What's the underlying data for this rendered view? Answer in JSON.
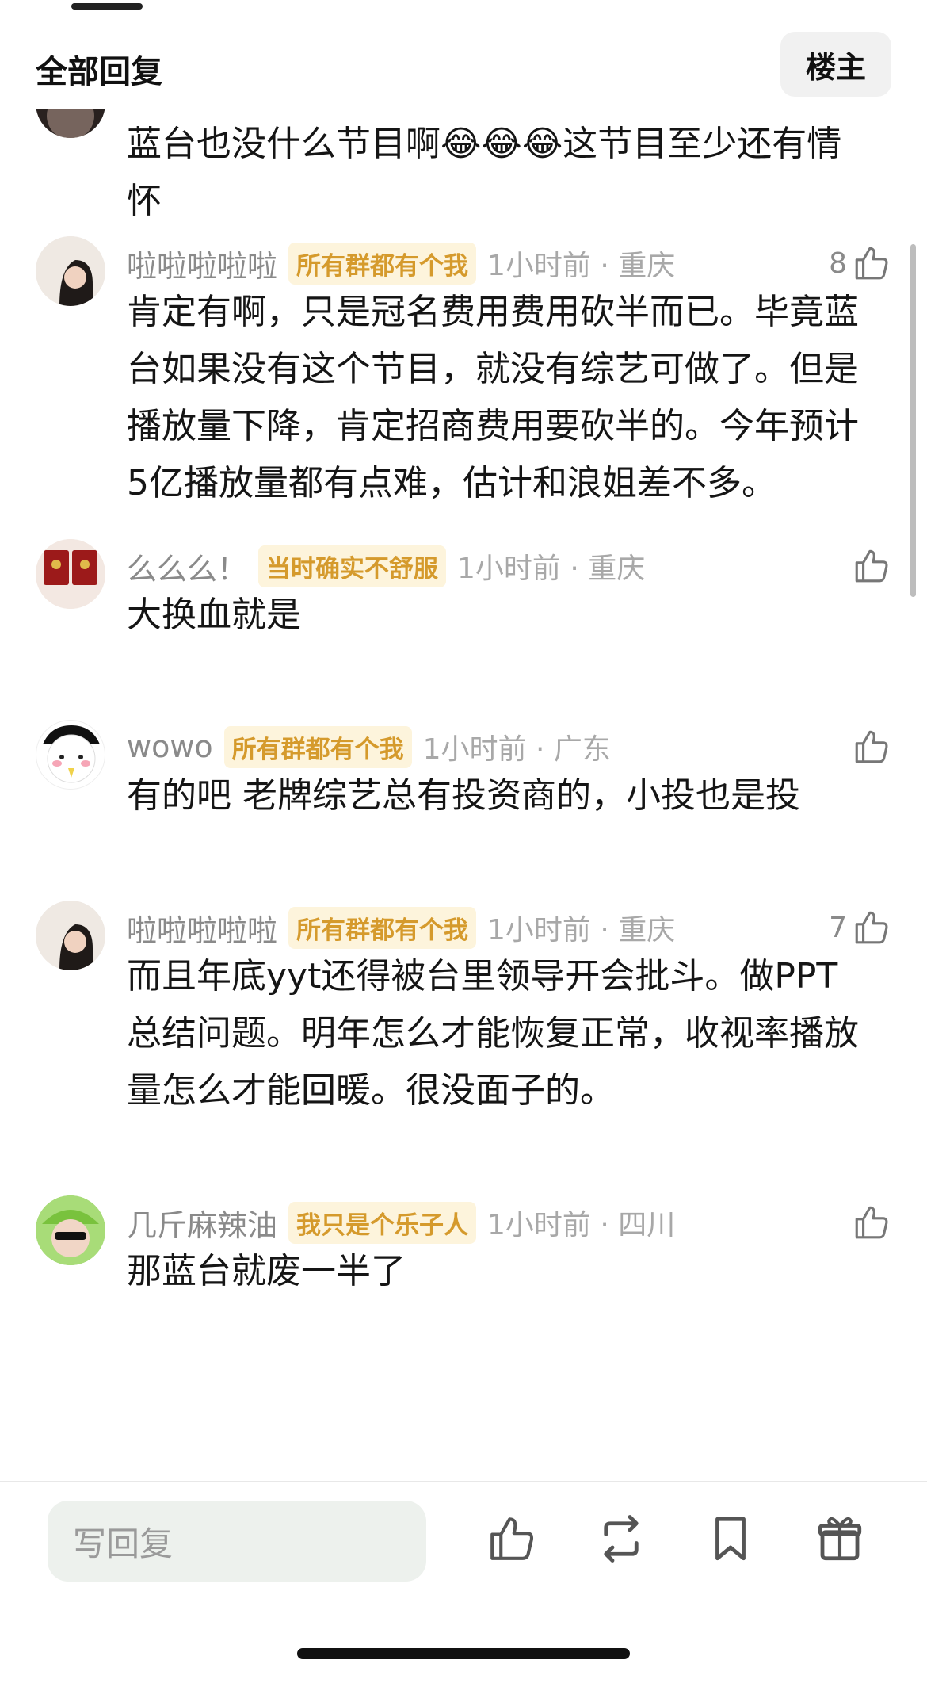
{
  "header": {
    "title": "全部回复",
    "op_toggle": "楼主"
  },
  "comments": [
    {
      "username": "",
      "badge": "",
      "time": "",
      "likes": "",
      "text": "蓝台也没什么节目啊😂😂😂这节目至少还有情怀"
    },
    {
      "username": "啦啦啦啦啦",
      "badge": "所有群都有个我",
      "time": "1小时前 · 重庆",
      "likes": "8",
      "text": "肯定有啊，只是冠名费用费用砍半而已。毕竟蓝台如果没有这个节目，就没有综艺可做了。但是播放量下降，肯定招商费用要砍半的。今年预计5亿播放量都有点难，估计和浪姐差不多。"
    },
    {
      "username": "么么么！",
      "badge": "当时确实不舒服",
      "time": "1小时前 · 重庆",
      "likes": "",
      "text": "大换血就是"
    },
    {
      "username": "wowo",
      "badge": "所有群都有个我",
      "time": "1小时前 · 广东",
      "likes": "",
      "text": "有的吧 老牌综艺总有投资商的，小投也是投"
    },
    {
      "username": "啦啦啦啦啦",
      "badge": "所有群都有个我",
      "time": "1小时前 · 重庆",
      "likes": "7",
      "text": "而且年底yyt还得被台里领导开会批斗。做PPT总结问题。明年怎么才能恢复正常，收视率播放量怎么才能回暖。很没面子的。"
    },
    {
      "username": "几斤麻辣油",
      "badge": "我只是个乐子人",
      "time": "1小时前 · 四川",
      "likes": "",
      "text": "那蓝台就废一半了"
    }
  ],
  "bottom_bar": {
    "reply_placeholder": "写回复"
  },
  "icons": {
    "like": "thumbs-up-icon",
    "repost": "repost-icon",
    "favorite": "bookmark-icon",
    "gift": "gift-icon"
  },
  "colors": {
    "badge_bg": "#fdf4dc",
    "badge_text": "#d59a2c",
    "input_bg": "#edf1ed"
  }
}
